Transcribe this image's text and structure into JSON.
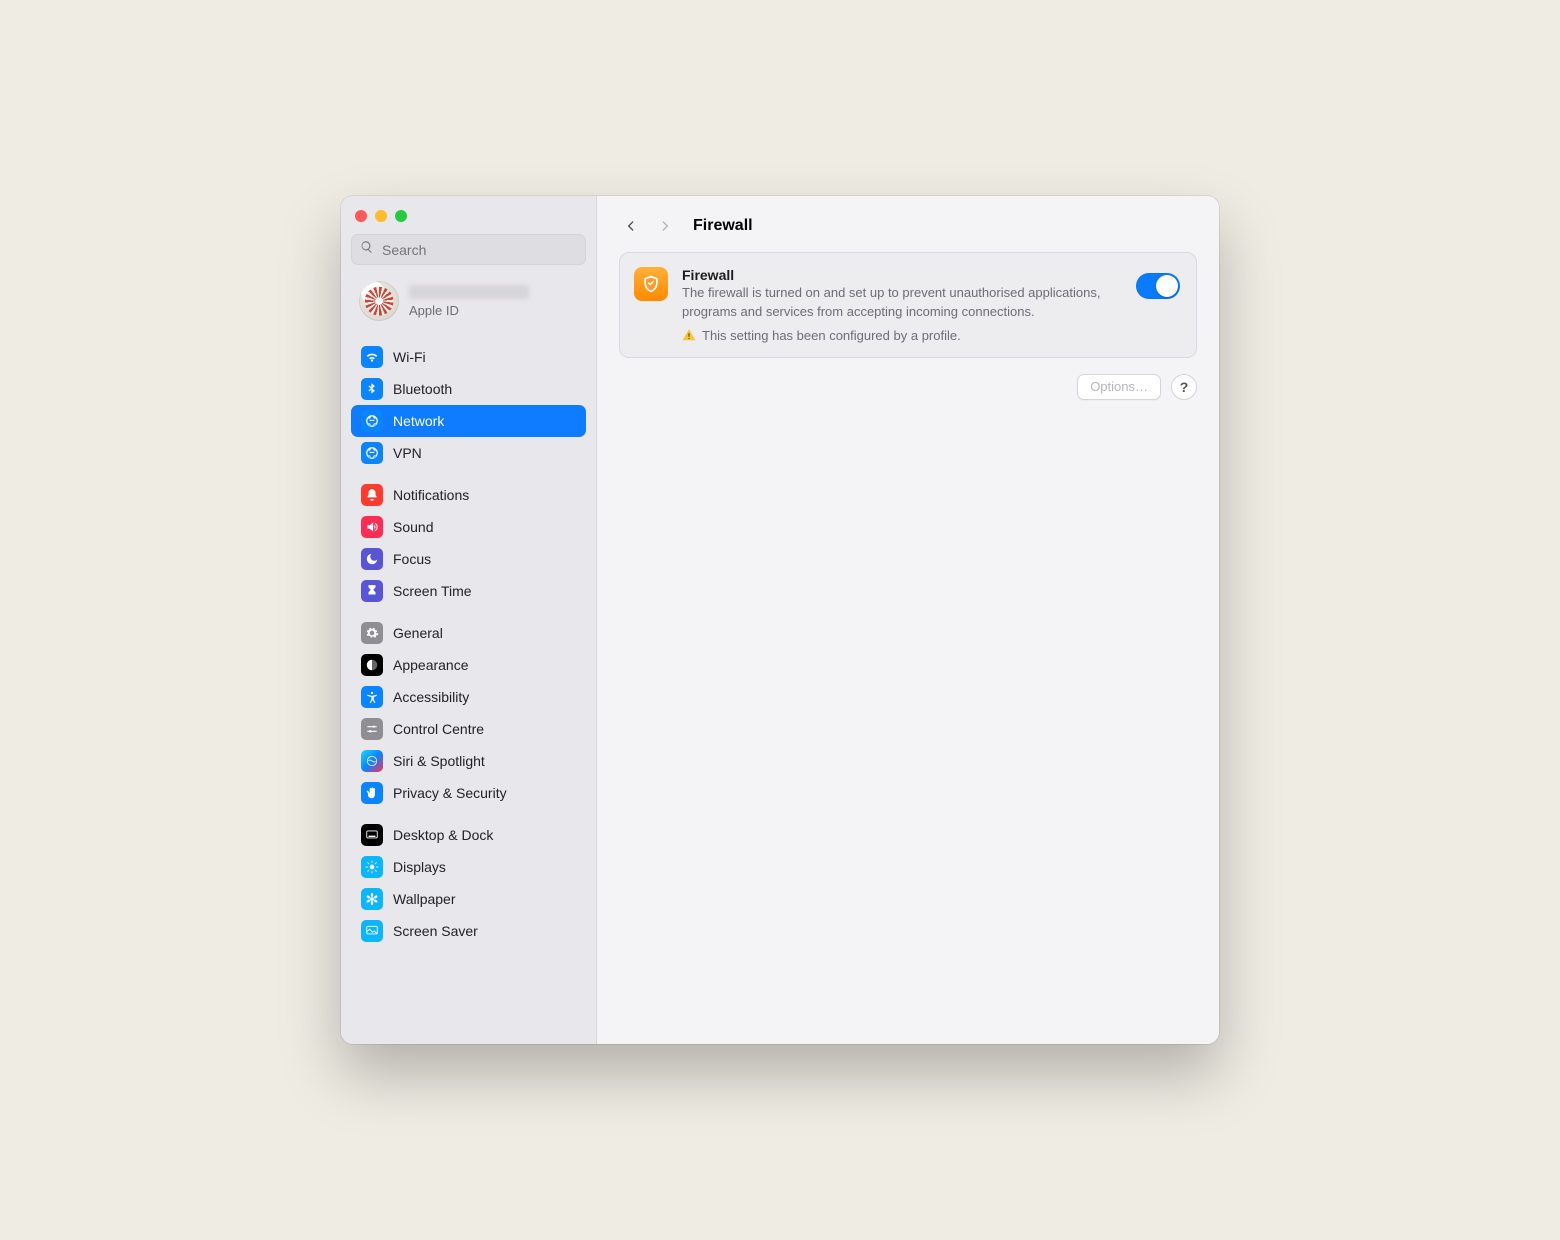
{
  "search": {
    "placeholder": "Search"
  },
  "account": {
    "subtitle": "Apple ID"
  },
  "sidebar": {
    "groups": [
      {
        "items": [
          "Wi-Fi",
          "Bluetooth",
          "Network",
          "VPN"
        ]
      },
      {
        "items": [
          "Notifications",
          "Sound",
          "Focus",
          "Screen Time"
        ]
      },
      {
        "items": [
          "General",
          "Appearance",
          "Accessibility",
          "Control Centre",
          "Siri & Spotlight",
          "Privacy & Security"
        ]
      },
      {
        "items": [
          "Desktop & Dock",
          "Displays",
          "Wallpaper",
          "Screen Saver"
        ]
      }
    ],
    "selected": "Network"
  },
  "page": {
    "title": "Firewall",
    "card": {
      "title": "Firewall",
      "description": "The firewall is turned on and set up to prevent unauthorised applications, programs and services from accepting incoming connections.",
      "profile_note": "This setting has been configured by a profile.",
      "toggle_on": true
    },
    "options_label": "Options…",
    "options_disabled": true,
    "help_label": "?"
  },
  "icons": {
    "Wi-Fi": {
      "bg": "#0b84ff",
      "name": "wifi-icon"
    },
    "Bluetooth": {
      "bg": "#0b84ff",
      "name": "bluetooth-icon"
    },
    "Network": {
      "bg": "#0b84ff",
      "name": "globe-icon"
    },
    "VPN": {
      "bg": "#0b84ff",
      "name": "globe-icon"
    },
    "Notifications": {
      "bg": "#ff3b30",
      "name": "bell-icon"
    },
    "Sound": {
      "bg": "#ff2d55",
      "name": "speaker-icon"
    },
    "Focus": {
      "bg": "#5856d6",
      "name": "moon-icon"
    },
    "Screen Time": {
      "bg": "#5856d6",
      "name": "hourglass-icon"
    },
    "General": {
      "bg": "#8e8e93",
      "name": "gear-icon"
    },
    "Appearance": {
      "bg": "#000000",
      "name": "appearance-icon"
    },
    "Accessibility": {
      "bg": "#0b84ff",
      "name": "accessibility-icon"
    },
    "Control Centre": {
      "bg": "#8e8e93",
      "name": "sliders-icon"
    },
    "Siri & Spotlight": {
      "bg": "linear-gradient(135deg,#26d4ff,#0a84ff,#ff2d55)",
      "name": "siri-icon"
    },
    "Privacy & Security": {
      "bg": "#0b84ff",
      "name": "hand-icon"
    },
    "Desktop & Dock": {
      "bg": "#000000",
      "name": "dock-icon"
    },
    "Displays": {
      "bg": "#0bb5ff",
      "name": "sun-icon"
    },
    "Wallpaper": {
      "bg": "#0bb5ff",
      "name": "flower-icon"
    },
    "Screen Saver": {
      "bg": "#0bb5ff",
      "name": "screensaver-icon"
    }
  }
}
